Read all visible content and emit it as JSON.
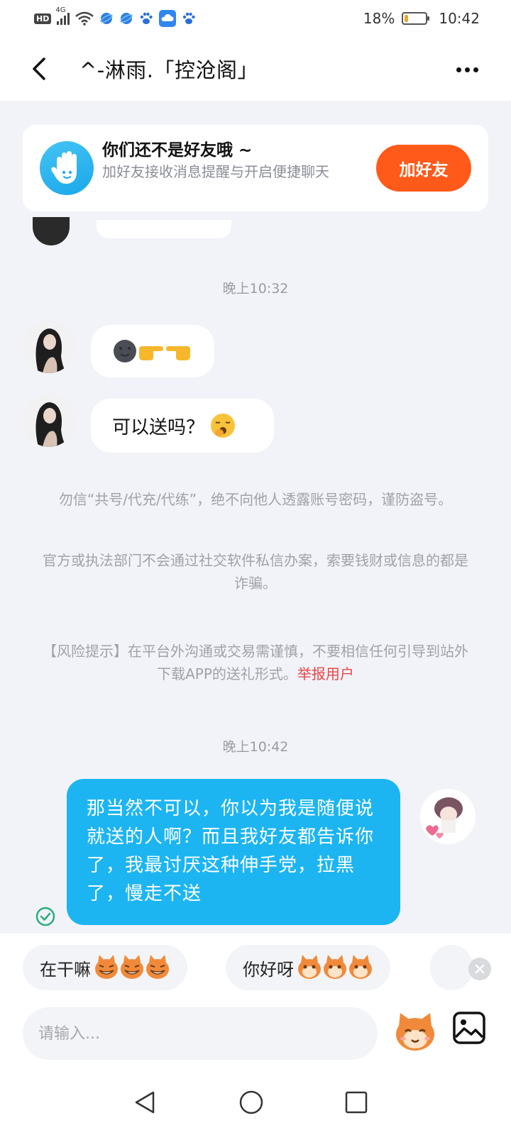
{
  "status_bar": {
    "network_badge": "HD",
    "network_type": "4G",
    "battery_percent": "18%",
    "battery_level": 0.18,
    "time": "10:42",
    "icons": [
      "hd-icon",
      "signal-icon",
      "wifi-icon",
      "globe-icon",
      "globe-icon",
      "paw-icon",
      "cloud-icon",
      "paw-icon"
    ]
  },
  "header": {
    "title": "^-淋雨.「控沧阁」",
    "back_icon": "chevron-left-icon",
    "more_icon": "more-dots-icon"
  },
  "friend_prompt": {
    "icon": "hand-wave-icon",
    "title": "你们还不是好友哦 ~",
    "subtitle": "加好友接收消息提醒与开启便捷聊天",
    "button_label": "加好友"
  },
  "chat": {
    "timestamp_1": "晚上10:32",
    "message_1": {
      "sender": "other",
      "emojis": [
        "new-moon-face-emoji",
        "pointing-right-emoji",
        "pointing-left-emoji"
      ]
    },
    "message_2": {
      "sender": "other",
      "text": "可以送吗？",
      "emoji": "yawning-face-emoji"
    },
    "notice_1": "勿信“共号/代充/代练”，绝不向他人透露账号密码，谨防盗号。",
    "notice_2": "官方或执法部门不会通过社交软件私信办案，索要钱财或信息的都是诈骗。",
    "risk_notice": "【风险提示】在平台外沟通或交易需谨慎，不要相信任何引导到站外下载APP的送礼形式。",
    "report_link": "举报用户",
    "timestamp_2": "晚上10:42",
    "message_3": {
      "sender": "me",
      "text": "那当然不可以，你以为我是随便说就送的人啊？而且我好友都告诉你了，我最讨厌这种伸手党，拉黑了，慢走不送",
      "status_icon": "sent-check-icon"
    }
  },
  "quick_replies": [
    {
      "text": "在干嘛",
      "emoji_count": 3
    },
    {
      "text": "你好呀",
      "emoji_count": 3
    }
  ],
  "input": {
    "placeholder": "请输入..."
  },
  "colors": {
    "accent_blue": "#1cb5f2",
    "add_button": "#ff5a1a",
    "report_red": "#e84545",
    "background": "#f2f3f8"
  }
}
